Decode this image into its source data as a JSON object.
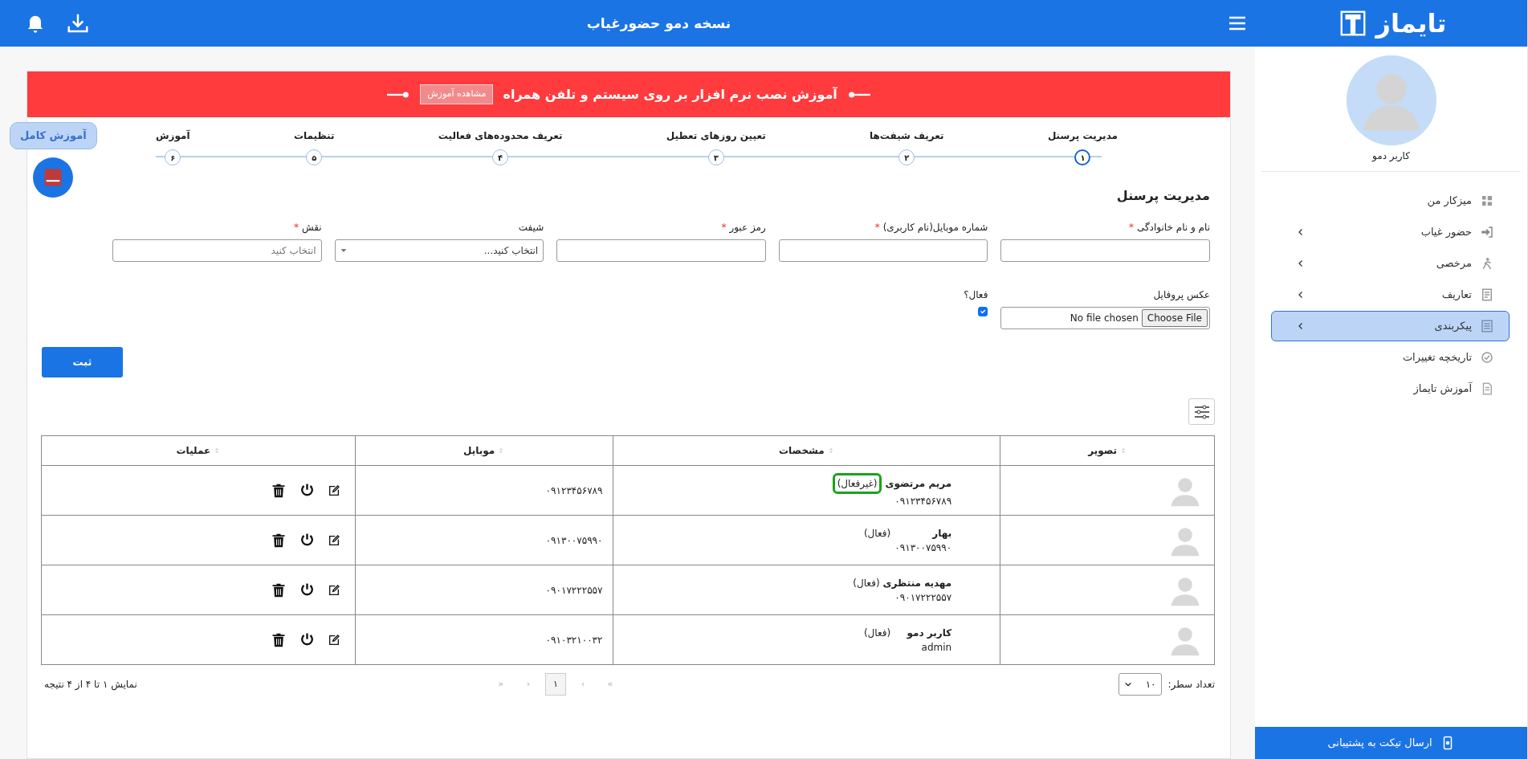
{
  "header": {
    "title": "نسخه دمو حضورغیاب"
  },
  "sidebar": {
    "logo_text": "تایماز",
    "user_name": "کاربر دمو",
    "items": [
      {
        "label": "میزکار من",
        "has_submenu": false,
        "selected": false
      },
      {
        "label": "حضور غیاب",
        "has_submenu": true,
        "selected": false
      },
      {
        "label": "مرخصی",
        "has_submenu": true,
        "selected": false
      },
      {
        "label": "تعاریف",
        "has_submenu": true,
        "selected": false
      },
      {
        "label": "پیکربندی",
        "has_submenu": true,
        "selected": true
      },
      {
        "label": "تاریخچه تغییرات",
        "has_submenu": false,
        "selected": false
      },
      {
        "label": "آموزش تایماز",
        "has_submenu": false,
        "selected": false
      }
    ],
    "support_button": "ارسال تیکت به پشتیبانی"
  },
  "banner": {
    "text": "آموزش نصب نرم افزار بر روی سیستم و تلفن همراه",
    "button": "مشاهده آموزش"
  },
  "tutorial_bubble": "آموزش کامل",
  "steps": [
    {
      "label": "مدیریت پرسنل",
      "number": "۱",
      "selected": true
    },
    {
      "label": "تعریف شیفت‌ها",
      "number": "۲",
      "selected": false
    },
    {
      "label": "تعیین روزهای تعطیل",
      "number": "۳",
      "selected": false
    },
    {
      "label": "تعریف محدوده‌های فعالیت",
      "number": "۴",
      "selected": false
    },
    {
      "label": "تنظیمات",
      "number": "۵",
      "selected": false
    },
    {
      "label": "آموزش",
      "number": "۶",
      "selected": false
    }
  ],
  "form": {
    "title": "مدیریت پرسنل",
    "required_mark": "*",
    "fields": [
      {
        "kind": "text",
        "label": "نام و نام خانوادگی",
        "required": true
      },
      {
        "kind": "text",
        "label": "شماره موبایل(نام کاربری)",
        "required": true
      },
      {
        "kind": "text",
        "label": "رمز عبور",
        "required": true
      },
      {
        "kind": "select",
        "label": "شیفت",
        "required": false,
        "placeholder": "انتخاب کنید..."
      },
      {
        "kind": "text",
        "label": "نقش",
        "required": true,
        "placeholder": "انتخاب کنید"
      }
    ],
    "photo": {
      "label": "عکس پروفایل",
      "button": "Choose File",
      "status": "No file chosen"
    },
    "active": {
      "label": "فعال؟",
      "checked": true
    },
    "submit": "ثبت"
  },
  "table": {
    "columns": [
      "تصویر",
      "مشخصات",
      "موبایل",
      "عملیات"
    ],
    "rows": [
      {
        "name": "مریم مرتضوی",
        "status": "(غیرفعال)",
        "subtitle": "۰۹۱۲۳۴۵۶۷۸۹",
        "mobile": "۰۹۱۲۳۴۵۶۷۸۹",
        "highlighted": true
      },
      {
        "name": "بهار",
        "status": "(فعال)",
        "subtitle": "۰۹۱۳۰۰۷۵۹۹۰",
        "mobile": "۰۹۱۳۰۰۷۵۹۹۰",
        "highlighted": false
      },
      {
        "name": "مهدیه منتظری",
        "status": "(فعال)",
        "subtitle": "۰۹۰۱۷۲۲۲۵۵۷",
        "mobile": "۰۹۰۱۷۲۲۲۵۵۷",
        "highlighted": false
      },
      {
        "name": "کاربر دمو",
        "status": "(فعال)",
        "subtitle": "admin",
        "mobile": "۰۹۱۰۳۲۱۰۰۳۲",
        "highlighted": false
      }
    ]
  },
  "footer": {
    "rows_label": "تعداد سطر:",
    "rows_value": "۱۰",
    "pages": [
      {
        "text": "»",
        "selected": false
      },
      {
        "text": "›",
        "selected": false
      },
      {
        "text": "۱",
        "selected": true
      },
      {
        "text": "‹",
        "selected": false
      },
      {
        "text": "«",
        "selected": false
      }
    ],
    "summary": "نمایش ۱ تا ۴ از ۴ نتیجه"
  }
}
